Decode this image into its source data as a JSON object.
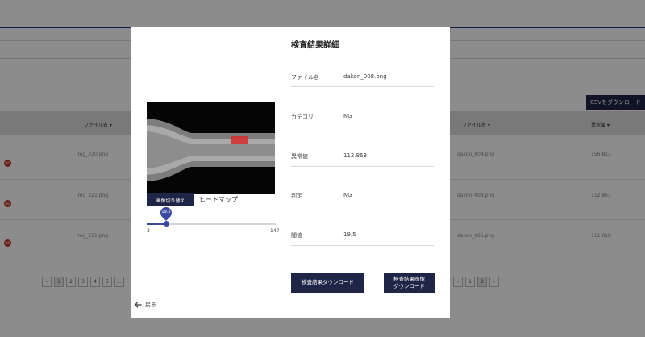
{
  "background": {
    "csv_button": "CSVをダウンロード",
    "headers": {
      "left_filename": "ファイル名 ▾",
      "right_filename": "ファイル名 ▾",
      "right_anomaly": "異常値 ▾"
    },
    "rows": [
      {
        "badge": "NG",
        "left_file": "img_220.png",
        "right_file": "dakon_004.png",
        "right_value": "156.813"
      },
      {
        "badge": "NG",
        "left_file": "img_221.png",
        "right_file": "dakon_008.png",
        "right_value": "112.863"
      },
      {
        "badge": "NG",
        "left_file": "img_211.png",
        "right_file": "dakon_005.png",
        "right_value": "111.018"
      }
    ],
    "pagination_left": [
      "‹",
      "1",
      "2",
      "3",
      "4",
      "5",
      "…"
    ],
    "pagination_right": [
      "‹",
      "1",
      "2",
      "›"
    ]
  },
  "modal": {
    "title": "検査結果詳細",
    "toggle_button": "画像切り替え",
    "heatmap_label": "ヒートマップ",
    "slider": {
      "value_label": "19.5",
      "value": 19.5,
      "min": -3,
      "max": 147,
      "min_label": "-3",
      "max_label": "147"
    },
    "fields": [
      {
        "label": "ファイル名",
        "value": "dakon_008.png"
      },
      {
        "label": "カテゴリ",
        "value": "NG"
      },
      {
        "label": "異常値",
        "value": "112.863"
      },
      {
        "label": "判定",
        "value": "NG"
      },
      {
        "label": "閾値",
        "value": "19.5"
      }
    ],
    "download_result_button": "検査結果ダウンロード",
    "download_image_button_line1": "検査結果画像",
    "download_image_button_line2": "ダウンロード",
    "back_icon": "arrow-left-icon",
    "back_label": "戻る",
    "colors": {
      "primary": "#1f2547",
      "accent": "#3a4aa0",
      "defect": "#d62d2d"
    }
  }
}
